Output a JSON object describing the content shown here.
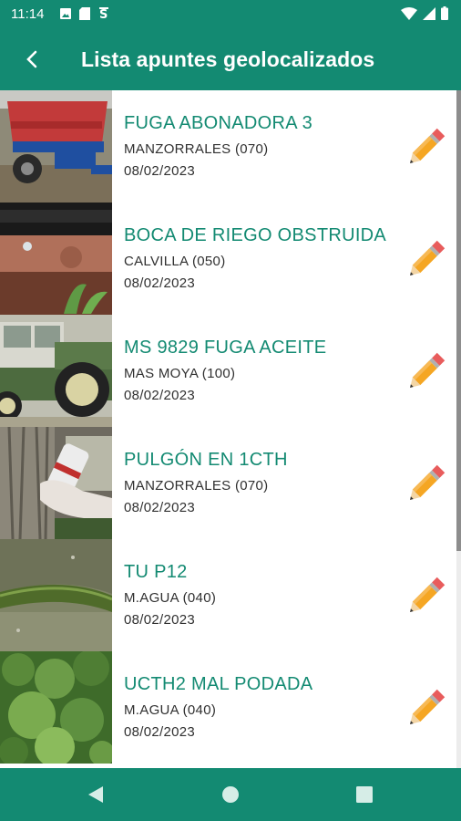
{
  "status_bar": {
    "time": "11:14"
  },
  "app_bar": {
    "title": "Lista apuntes geolocalizados"
  },
  "items": [
    {
      "title": "FUGA ABONADORA 3",
      "location": "MANZORRALES (070)",
      "date": "08/02/2023",
      "thumbnail": "fertilizer-spreader-photo"
    },
    {
      "title": "BOCA DE RIEGO OBSTRUIDA",
      "location": "CALVILLA (050)",
      "date": "08/02/2023",
      "thumbnail": "drip-irrigation-photo"
    },
    {
      "title": "MS 9829 FUGA ACEITE",
      "location": "MAS MOYA (100)",
      "date": "08/02/2023",
      "thumbnail": "tractor-photo"
    },
    {
      "title": "PULGÓN EN 1CTH",
      "location": "MANZORRALES (070)",
      "date": "08/02/2023",
      "thumbnail": "tree-trunk-photo"
    },
    {
      "title": "TU P12",
      "location": "M.AGUA (040)",
      "date": "08/02/2023",
      "thumbnail": "pipe-on-ground-photo"
    },
    {
      "title": "UCTH2 MAL PODADA",
      "location": "M.AGUA (040)",
      "date": "08/02/2023",
      "thumbnail": "plant-leaves-photo"
    }
  ],
  "colors": {
    "primary": "#138a72",
    "title_text": "#138a72",
    "body_text": "#303030"
  }
}
